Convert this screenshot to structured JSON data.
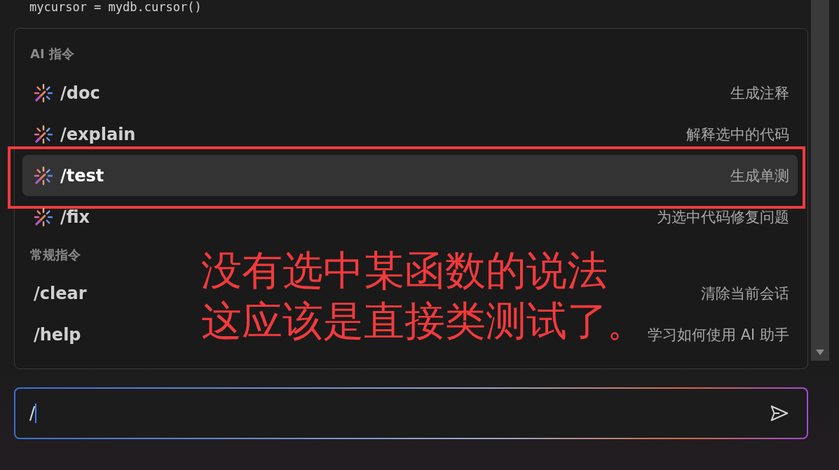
{
  "editor": {
    "code_line": "mycursor = mydb.cursor()"
  },
  "command_menu": {
    "sections": [
      {
        "title": "AI 指令",
        "items": [
          {
            "command": "/doc",
            "description": "生成注释",
            "kind": "ai",
            "selected": false
          },
          {
            "command": "/explain",
            "description": "解释选中的代码",
            "kind": "ai",
            "selected": false
          },
          {
            "command": "/test",
            "description": "生成单测",
            "kind": "ai",
            "selected": true,
            "annotated": true
          },
          {
            "command": "/fix",
            "description": "为选中代码修复问题",
            "kind": "ai",
            "selected": false
          }
        ]
      },
      {
        "title": "常规指令",
        "items": [
          {
            "command": "/clear",
            "description": "清除当前会话",
            "kind": "plain",
            "selected": false
          },
          {
            "command": "/help",
            "description": "学习如何使用 AI 助手",
            "kind": "plain",
            "selected": false
          }
        ]
      }
    ]
  },
  "annotation": {
    "lines": [
      "没有选中某函数的说法",
      "这应该是直接类测试了"
    ]
  },
  "chat_input": {
    "value": "/"
  }
}
